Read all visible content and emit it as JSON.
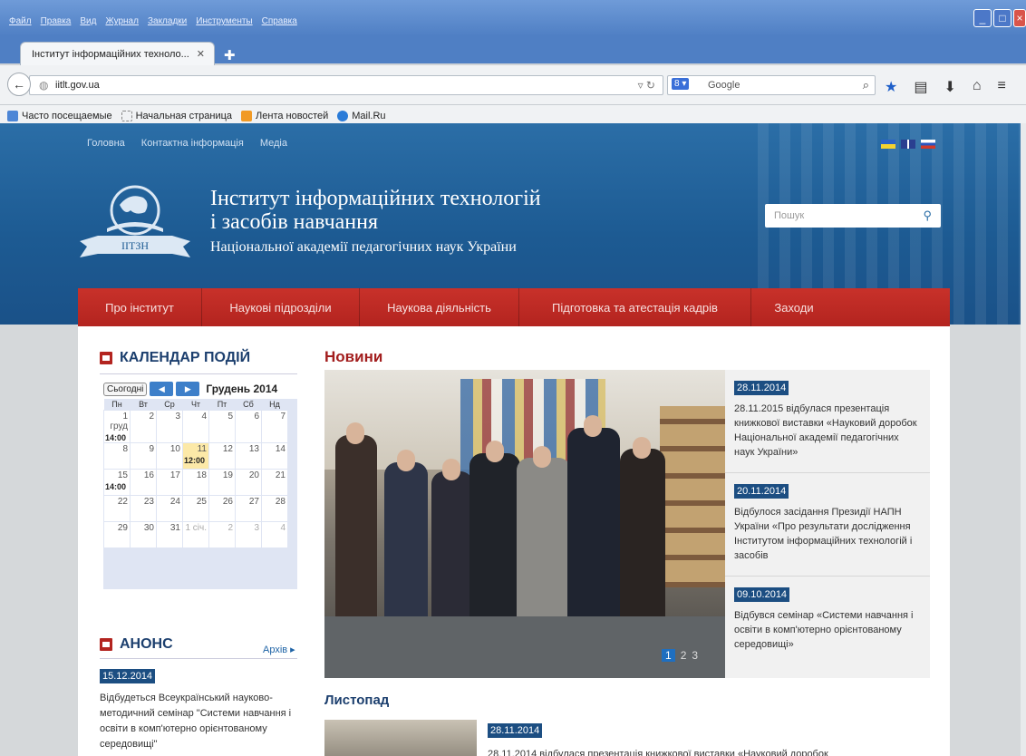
{
  "browser": {
    "menu": [
      "Файл",
      "Правка",
      "Вид",
      "Журнал",
      "Закладки",
      "Инструменты",
      "Справка"
    ],
    "tab_title": "Інститут інформаційних техноло...",
    "url": "iitlt.gov.ua",
    "search_engine": "Google",
    "bookmarks": [
      "Часто посещаемые",
      "Начальная страница",
      "Лента новостей",
      "Mail.Ru"
    ]
  },
  "header": {
    "top_nav": [
      "Головна",
      "Контактна інформація",
      "Медіа"
    ],
    "logo_text": "ІІТЗН",
    "title_line1": "Інститут інформаційних технологій",
    "title_line2": "і засобів навчання",
    "subtitle": "Національної академії педагогічних наук України",
    "search_placeholder": "Пошук"
  },
  "main_nav": [
    "Про інститут",
    "Наукові підрозділи",
    "Наукова діяльність",
    "Підготовка та атестація кадрів",
    "Заходи"
  ],
  "calendar": {
    "heading": "КАЛЕНДАР ПОДІЙ",
    "today_label": "Сьогодні",
    "month_label": "Грудень 2014",
    "weekdays": [
      "Пн",
      "Вт",
      "Ср",
      "Чт",
      "Пт",
      "Сб",
      "Нд"
    ],
    "weeks": [
      [
        {
          "d": "1 груд",
          "e": "14:00"
        },
        {
          "d": "2"
        },
        {
          "d": "3"
        },
        {
          "d": "4"
        },
        {
          "d": "5"
        },
        {
          "d": "6"
        },
        {
          "d": "7"
        }
      ],
      [
        {
          "d": "8"
        },
        {
          "d": "9"
        },
        {
          "d": "10"
        },
        {
          "d": "11",
          "e": "12:00",
          "today": true
        },
        {
          "d": "12"
        },
        {
          "d": "13"
        },
        {
          "d": "14"
        }
      ],
      [
        {
          "d": "15",
          "e": "14:00"
        },
        {
          "d": "16"
        },
        {
          "d": "17"
        },
        {
          "d": "18"
        },
        {
          "d": "19"
        },
        {
          "d": "20"
        },
        {
          "d": "21"
        }
      ],
      [
        {
          "d": "22"
        },
        {
          "d": "23"
        },
        {
          "d": "24"
        },
        {
          "d": "25"
        },
        {
          "d": "26"
        },
        {
          "d": "27"
        },
        {
          "d": "28"
        }
      ],
      [
        {
          "d": "29"
        },
        {
          "d": "30"
        },
        {
          "d": "31"
        },
        {
          "d": "1 січ.",
          "muted": true
        },
        {
          "d": "2",
          "muted": true
        },
        {
          "d": "3",
          "muted": true
        },
        {
          "d": "4",
          "muted": true
        }
      ]
    ]
  },
  "anons": {
    "heading": "АНОНС",
    "archive": "Архів ▸",
    "date": "15.12.2014",
    "text": "Відбудеться Всеукраїнський науково-методичний семінар \"Системи навчання і освіти в комп'ютерно орієнтованому середовищі\""
  },
  "news": {
    "heading": "Новини",
    "pages": [
      "1",
      "2",
      "3"
    ],
    "items": [
      {
        "date": "28.11.2014",
        "text": "28.11.2015 відбулася презентація книжкової виставки «Науковий доробок Національної академії педагогічних наук України»"
      },
      {
        "date": "20.11.2014",
        "text": "Відбулося засідання Президії НАПН України «Про результати дослідження Інститутом інформаційних технологій і засобів"
      },
      {
        "date": "09.10.2014",
        "text": "Відбувся семінар «Системи навчання і освіти в комп'ютерно орієнтованому середовищі»"
      }
    ]
  },
  "november": {
    "heading": "Листопад",
    "date": "28.11.2014",
    "text": "28.11.2014 відбулася презентація книжкової виставки «Науковий доробок"
  },
  "colors": {
    "nav_red": "#b3241f",
    "header_blue": "#1d5b93",
    "date_badge": "#1c4e82",
    "news_title": "#a21d1d"
  }
}
